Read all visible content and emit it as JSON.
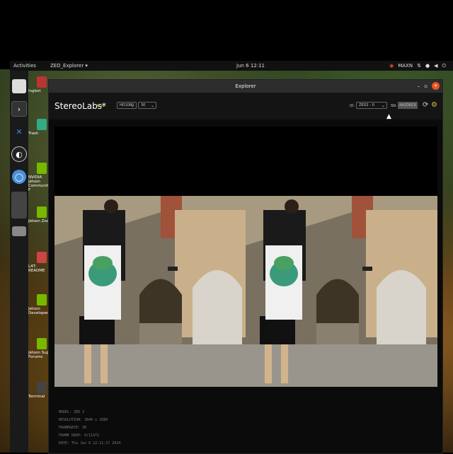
{
  "topbar": {
    "activities": "Activities",
    "app_menu": "ZED_Explorer ▾",
    "clock": "Jun 6  12:11",
    "power_mode": "MAXN"
  },
  "desktop_icons": [
    {
      "label": "lngbot",
      "color": "#b33"
    },
    {
      "label": "Trash",
      "color": "#3a8"
    },
    {
      "label": "NVIDIA Jetson Community F",
      "color": "#76b900"
    },
    {
      "label": "Jetson Zoo",
      "color": "#76b900"
    },
    {
      "label": "L4T-README",
      "color": "#c44"
    },
    {
      "label": "Jetson Developer Z",
      "color": "#76b900"
    },
    {
      "label": "Jetson Supp Forums",
      "color": "#76b900"
    },
    {
      "label": "Terminal",
      "color": "#444"
    }
  ],
  "window": {
    "title": "Explorer",
    "brand": "StereoLabs*",
    "live_badge": "LIVE",
    "resolution_select": "HD1080",
    "fps_select": "30",
    "id_label": "ID:",
    "id_select": "ZED2 - 0",
    "sn_label": "SN:",
    "sn_value": "AA2D6C6"
  },
  "camera_info": {
    "model": "MODEL: ZED 2",
    "resolution": "RESOLUTION: 3840 x 1080",
    "framerate": "FRAMERATE: 30",
    "frame_drop": "FRAME DROP: 0/11472",
    "date": "DATE: Thu Jun 6 12:11:17 2024"
  }
}
